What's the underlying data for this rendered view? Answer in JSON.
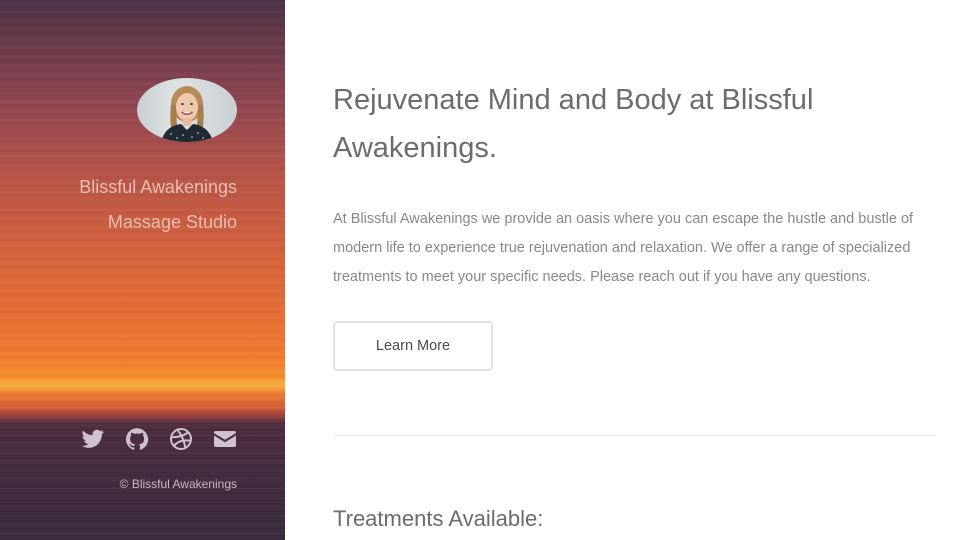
{
  "sidebar": {
    "avatar_alt": "Profile photo",
    "studio_name_line1": "Blissful Awakenings",
    "studio_name_line2": "Massage Studio",
    "social": [
      {
        "icon": "twitter-icon"
      },
      {
        "icon": "github-icon"
      },
      {
        "icon": "dribbble-icon"
      },
      {
        "icon": "envelope-icon"
      }
    ],
    "copyright": "© Blissful Awakenings"
  },
  "main": {
    "headline": "Rejuvenate Mind and Body at Blissful Awakenings.",
    "intro": "At Blissful Awakenings we provide an oasis where you can escape the hustle and bustle of modern life to experience true rejuvenation and relaxation. We offer a range of specialized treatments to meet your specific needs. Please reach out if you have any questions.",
    "cta_label": "Learn More",
    "section_title": "Treatments Available:"
  },
  "colors": {
    "sidebar_text": "#f1c7bc",
    "icon": "#cfc2cc",
    "heading": "#6c6c6c",
    "body_text": "#888888",
    "button_border": "#e3e3e3",
    "divider": "#e6e6e6"
  }
}
